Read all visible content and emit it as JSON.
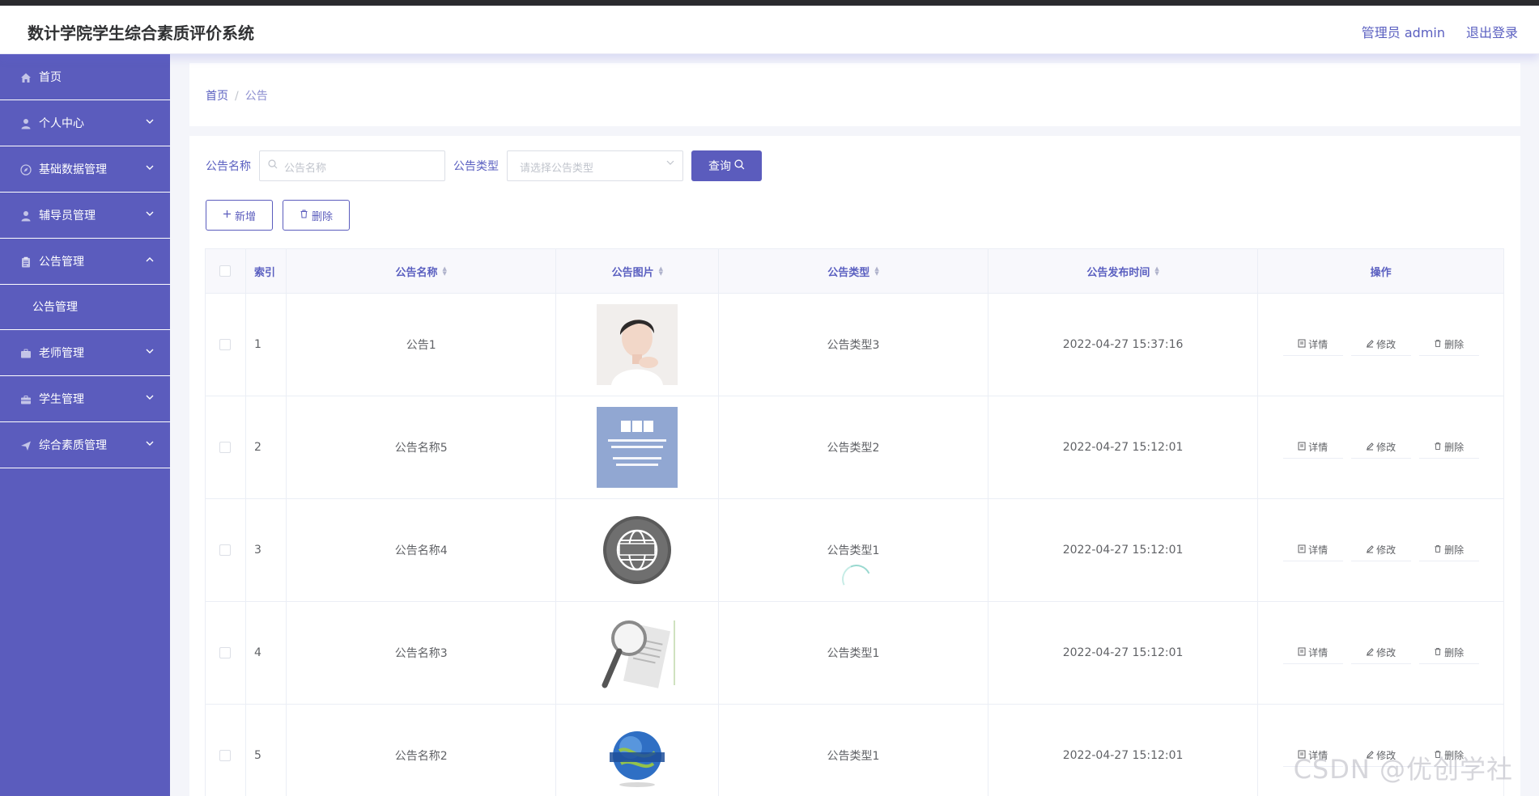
{
  "app": {
    "title": "数计学院学生综合素质评价系统",
    "user_label": "管理员 admin",
    "logout_label": "退出登录"
  },
  "sidebar": {
    "items": [
      {
        "label": "首页",
        "icon": "home-icon",
        "has_children": false
      },
      {
        "label": "个人中心",
        "icon": "user-icon",
        "has_children": true,
        "expanded": false
      },
      {
        "label": "基础数据管理",
        "icon": "compass-icon",
        "has_children": true,
        "expanded": false
      },
      {
        "label": "辅导员管理",
        "icon": "user-icon",
        "has_children": true,
        "expanded": false
      },
      {
        "label": "公告管理",
        "icon": "clipboard-icon",
        "has_children": true,
        "expanded": true,
        "children": [
          {
            "label": "公告管理"
          }
        ]
      },
      {
        "label": "老师管理",
        "icon": "briefcase-icon",
        "has_children": true,
        "expanded": false
      },
      {
        "label": "学生管理",
        "icon": "suitcase-icon",
        "has_children": true,
        "expanded": false
      },
      {
        "label": "综合素质管理",
        "icon": "send-icon",
        "has_children": true,
        "expanded": false
      }
    ]
  },
  "breadcrumb": {
    "home": "首页",
    "separator": "/",
    "current": "公告"
  },
  "search": {
    "name_label": "公告名称",
    "name_placeholder": "公告名称",
    "type_label": "公告类型",
    "type_placeholder": "请选择公告类型",
    "query_label": "查询"
  },
  "actions": {
    "add_label": "新增",
    "delete_label": "删除"
  },
  "table": {
    "columns": [
      "索引",
      "公告名称",
      "公告图片",
      "公告类型",
      "公告发布时间",
      "操作"
    ],
    "op_labels": {
      "detail": "详情",
      "edit": "修改",
      "delete": "删除"
    },
    "rows": [
      {
        "index": "1",
        "name": "公告1",
        "image": "portrait-photo",
        "type": "公告类型3",
        "time": "2022-04-27 15:37:16"
      },
      {
        "index": "2",
        "name": "公告名称5",
        "image": "bbc-world-news-logo",
        "type": "公告类型2",
        "time": "2022-04-27 15:12:01"
      },
      {
        "index": "3",
        "name": "公告名称4",
        "image": "news-globe-badge",
        "type": "公告类型1",
        "time": "2022-04-27 15:12:01"
      },
      {
        "index": "4",
        "name": "公告名称3",
        "image": "magnifier-newspaper",
        "type": "公告类型1",
        "time": "2022-04-27 15:12:01"
      },
      {
        "index": "5",
        "name": "公告名称2",
        "image": "news-globe-blue",
        "type": "公告类型1",
        "time": "2022-04-27 15:12:01"
      }
    ]
  },
  "watermark": "CSDN @优创学社",
  "colors": {
    "accent": "#5b5cbd",
    "sidebar_bg": "#5b5cbd",
    "link": "#5a5fc0"
  }
}
